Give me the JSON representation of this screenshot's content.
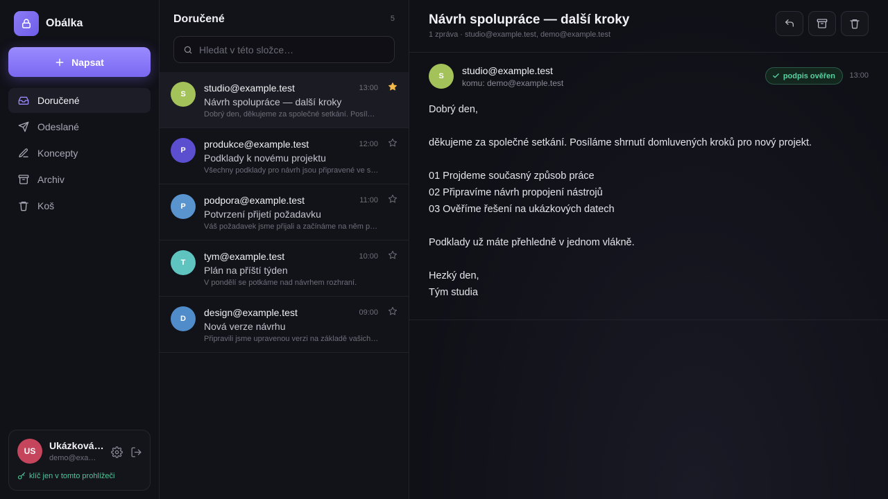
{
  "app": {
    "name": "Obálka"
  },
  "sidebar": {
    "compose_label": "Napsat",
    "items": [
      {
        "label": "Doručené",
        "icon": "inbox-icon",
        "active": true
      },
      {
        "label": "Odeslané",
        "icon": "send-icon",
        "active": false
      },
      {
        "label": "Koncepty",
        "icon": "pen-icon",
        "active": false
      },
      {
        "label": "Archiv",
        "icon": "archive-icon",
        "active": false
      },
      {
        "label": "Koš",
        "icon": "trash-icon",
        "active": false
      }
    ],
    "account": {
      "initials": "US",
      "name": "Ukázková…",
      "email": "demo@exa…",
      "key_note": "klíč jen v tomto prohlížeči"
    }
  },
  "list": {
    "title": "Doručené",
    "count": "5",
    "search_placeholder": "Hledat v této složce…",
    "messages": [
      {
        "initial": "S",
        "color": "#a3c35a",
        "from": "studio@example.test",
        "time": "13:00",
        "subject": "Návrh spolupráce — další kroky",
        "preview": "Dobrý den, děkujeme za společné setkání. Posíláme shrnutí",
        "starred": true,
        "selected": true
      },
      {
        "initial": "P",
        "color": "#5b4fcf",
        "from": "produkce@example.test",
        "time": "12:00",
        "subject": "Podklady k novému projektu",
        "preview": "Všechny podklady pro návrh jsou připravené ve sdílené složce",
        "starred": false,
        "selected": false
      },
      {
        "initial": "P",
        "color": "#5a94cf",
        "from": "podpora@example.test",
        "time": "11:00",
        "subject": "Potvrzení přijetí požadavku",
        "preview": "Váš požadavek jsme přijali a začínáme na něm pracovat",
        "starred": false,
        "selected": false
      },
      {
        "initial": "T",
        "color": "#5fc4c0",
        "from": "tym@example.test",
        "time": "10:00",
        "subject": "Plán na příští týden",
        "preview": "V pondělí se potkáme nad návrhem rozhraní.",
        "starred": false,
        "selected": false
      },
      {
        "initial": "D",
        "color": "#4f8cc9",
        "from": "design@example.test",
        "time": "09:00",
        "subject": "Nová verze návrhu",
        "preview": "Připravili jsme upravenou verzi na základě vašich připomínek",
        "starred": false,
        "selected": false
      }
    ]
  },
  "reader": {
    "title": "Návrh spolupráce — další kroky",
    "meta": "1 zpráva · studio@example.test, demo@example.test",
    "message": {
      "initial": "S",
      "from": "studio@example.test",
      "to": "komu: demo@example.test",
      "badge": "podpis ověřen",
      "time": "13:00",
      "body": [
        "Dobrý den,",
        "",
        "děkujeme za společné setkání. Posíláme shrnutí domluvených kroků pro nový projekt.",
        "",
        "01  Projdeme současný způsob práce",
        "02  Připravíme návrh propojení nástrojů",
        "03  Ověříme řešení na ukázkových datech",
        "",
        "Podklady už máte přehledně v jednom vlákně.",
        "",
        "Hezký den,",
        "Tým studia"
      ]
    }
  },
  "colors": {
    "accent": "#8b7cf6",
    "star": "#f2b84b",
    "verified": "#5ad1a0"
  }
}
